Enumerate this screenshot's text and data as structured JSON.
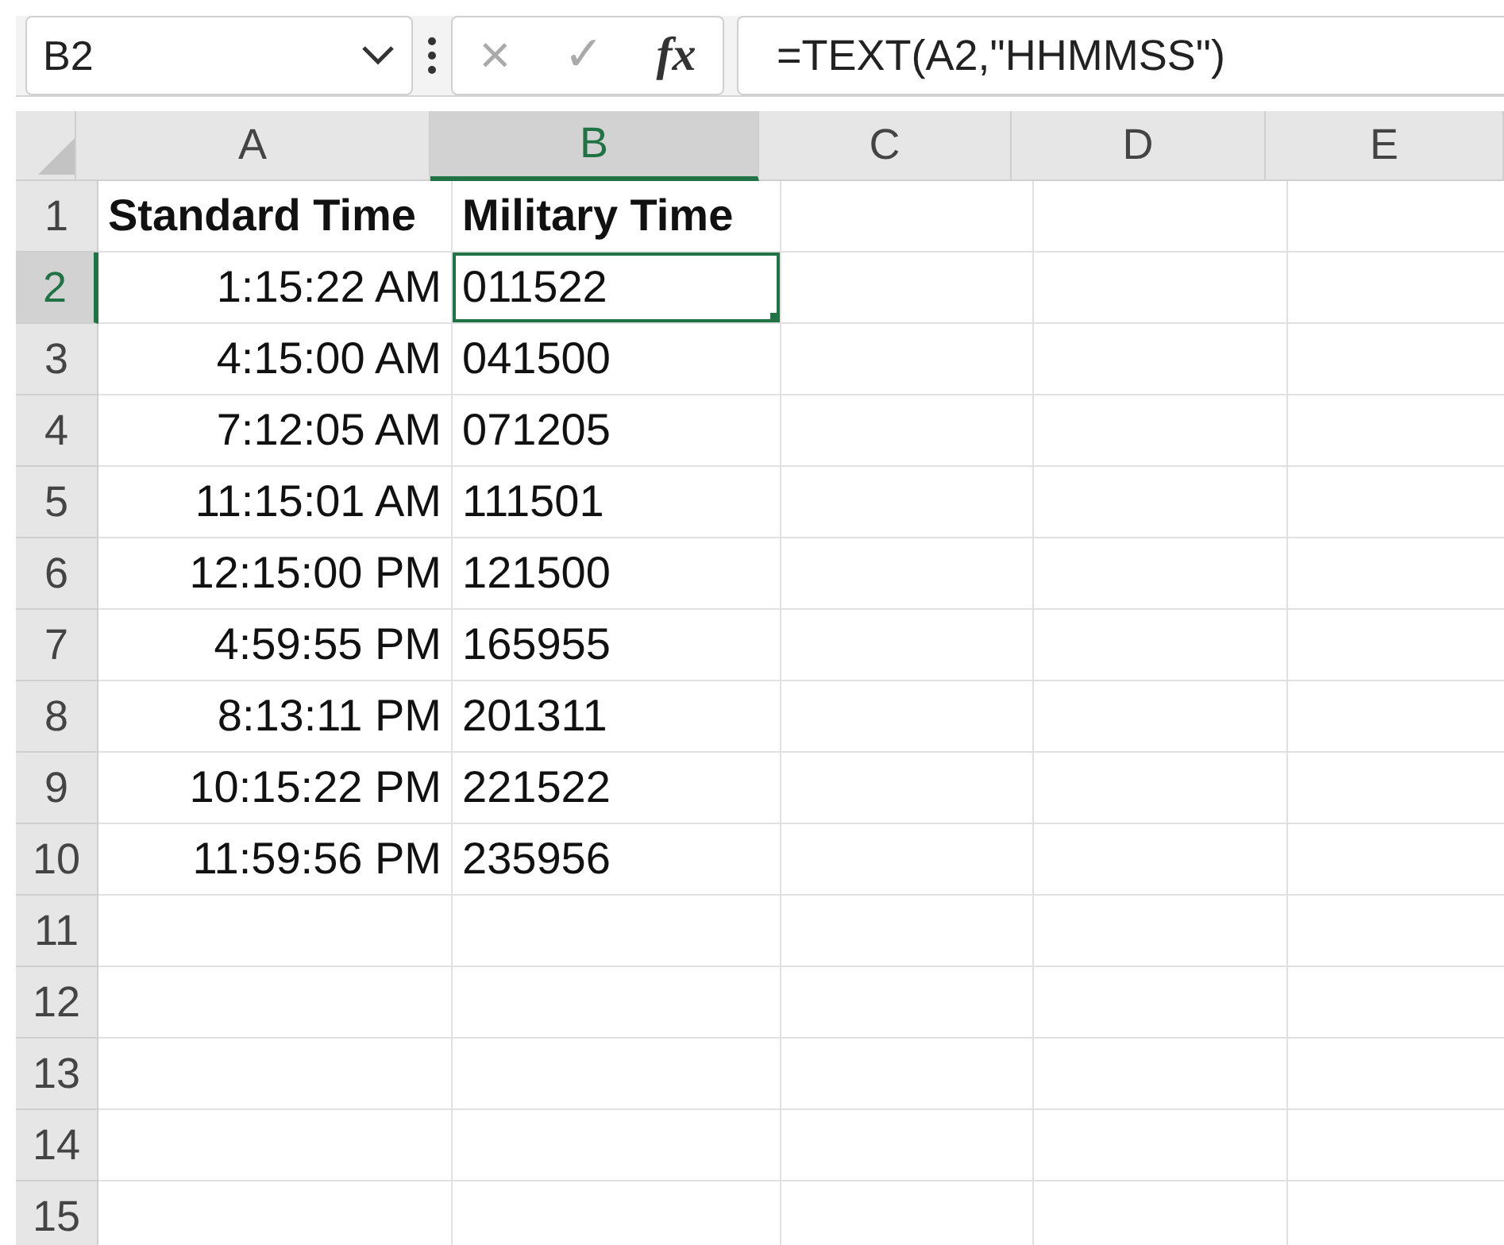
{
  "name_box": {
    "value": "B2"
  },
  "formula_bar": {
    "cancel": "×",
    "enter": "✓",
    "fx": "fx",
    "formula": "=TEXT(A2,\"HHMMSS\")"
  },
  "columns": [
    {
      "label": "A",
      "selected": false
    },
    {
      "label": "B",
      "selected": true
    },
    {
      "label": "C",
      "selected": false
    },
    {
      "label": "D",
      "selected": false
    },
    {
      "label": "E",
      "selected": false
    }
  ],
  "rows": [
    {
      "label": "1",
      "selected": false,
      "cells": [
        {
          "text": "Standard Time",
          "kind": "header"
        },
        {
          "text": "Military Time",
          "kind": "header"
        }
      ]
    },
    {
      "label": "2",
      "selected": true,
      "cells": [
        {
          "text": "1:15:22 AM",
          "kind": "time"
        },
        {
          "text": "011522",
          "kind": "text",
          "selected": true
        }
      ]
    },
    {
      "label": "3",
      "selected": false,
      "cells": [
        {
          "text": "4:15:00 AM",
          "kind": "time"
        },
        {
          "text": "041500",
          "kind": "text",
          "selected": false
        }
      ]
    },
    {
      "label": "4",
      "selected": false,
      "cells": [
        {
          "text": "7:12:05 AM",
          "kind": "time"
        },
        {
          "text": "071205",
          "kind": "text",
          "selected": false
        }
      ]
    },
    {
      "label": "5",
      "selected": false,
      "cells": [
        {
          "text": "11:15:01 AM",
          "kind": "time"
        },
        {
          "text": "111501",
          "kind": "text",
          "selected": false
        }
      ]
    },
    {
      "label": "6",
      "selected": false,
      "cells": [
        {
          "text": "12:15:00 PM",
          "kind": "time"
        },
        {
          "text": "121500",
          "kind": "text",
          "selected": false
        }
      ]
    },
    {
      "label": "7",
      "selected": false,
      "cells": [
        {
          "text": "4:59:55 PM",
          "kind": "time"
        },
        {
          "text": "165955",
          "kind": "text",
          "selected": false
        }
      ]
    },
    {
      "label": "8",
      "selected": false,
      "cells": [
        {
          "text": "8:13:11 PM",
          "kind": "time"
        },
        {
          "text": "201311",
          "kind": "text",
          "selected": false
        }
      ]
    },
    {
      "label": "9",
      "selected": false,
      "cells": [
        {
          "text": "10:15:22 PM",
          "kind": "time"
        },
        {
          "text": "221522",
          "kind": "text",
          "selected": false
        }
      ]
    },
    {
      "label": "10",
      "selected": false,
      "cells": [
        {
          "text": "11:59:56 PM",
          "kind": "time"
        },
        {
          "text": "235956",
          "kind": "text",
          "selected": false
        }
      ]
    },
    {
      "label": "11",
      "selected": false,
      "cells": []
    },
    {
      "label": "12",
      "selected": false,
      "cells": []
    },
    {
      "label": "13",
      "selected": false,
      "cells": []
    },
    {
      "label": "14",
      "selected": false,
      "cells": []
    },
    {
      "label": "15",
      "selected": false,
      "cells": []
    }
  ]
}
